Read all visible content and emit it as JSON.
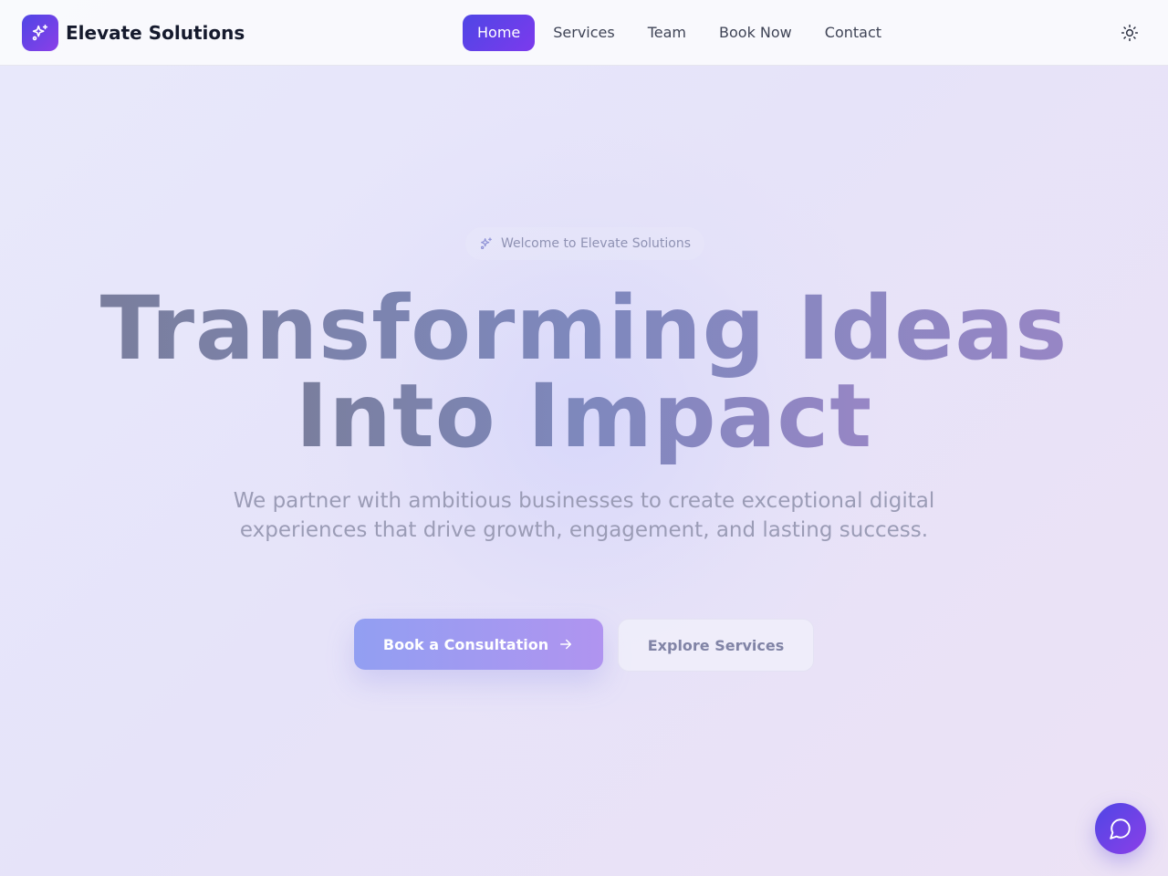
{
  "header": {
    "brand_name": "Elevate Solutions",
    "logo_icon": "sparkles-icon",
    "nav": [
      {
        "label": "Home",
        "active": true
      },
      {
        "label": "Services",
        "active": false
      },
      {
        "label": "Team",
        "active": false
      },
      {
        "label": "Book Now",
        "active": false
      },
      {
        "label": "Contact",
        "active": false
      }
    ],
    "theme_toggle_icon": "sun-icon"
  },
  "hero": {
    "badge_text": "Welcome to Elevate Solutions",
    "badge_icon": "sparkles-icon",
    "headline_line1": "Transforming Ideas",
    "headline_line2": "Into Impact",
    "subtitle": "We partner with ambitious businesses to create exceptional digital experiences that drive growth, engagement, and lasting success.",
    "primary_cta": "Book a Consultation",
    "primary_cta_icon": "arrow-right-icon",
    "secondary_cta": "Explore Services"
  },
  "chat": {
    "icon": "chat-bubble-icon"
  },
  "colors": {
    "accent_start": "#4f46e5",
    "accent_end": "#7c3aed",
    "text_dark": "#151a2d"
  }
}
